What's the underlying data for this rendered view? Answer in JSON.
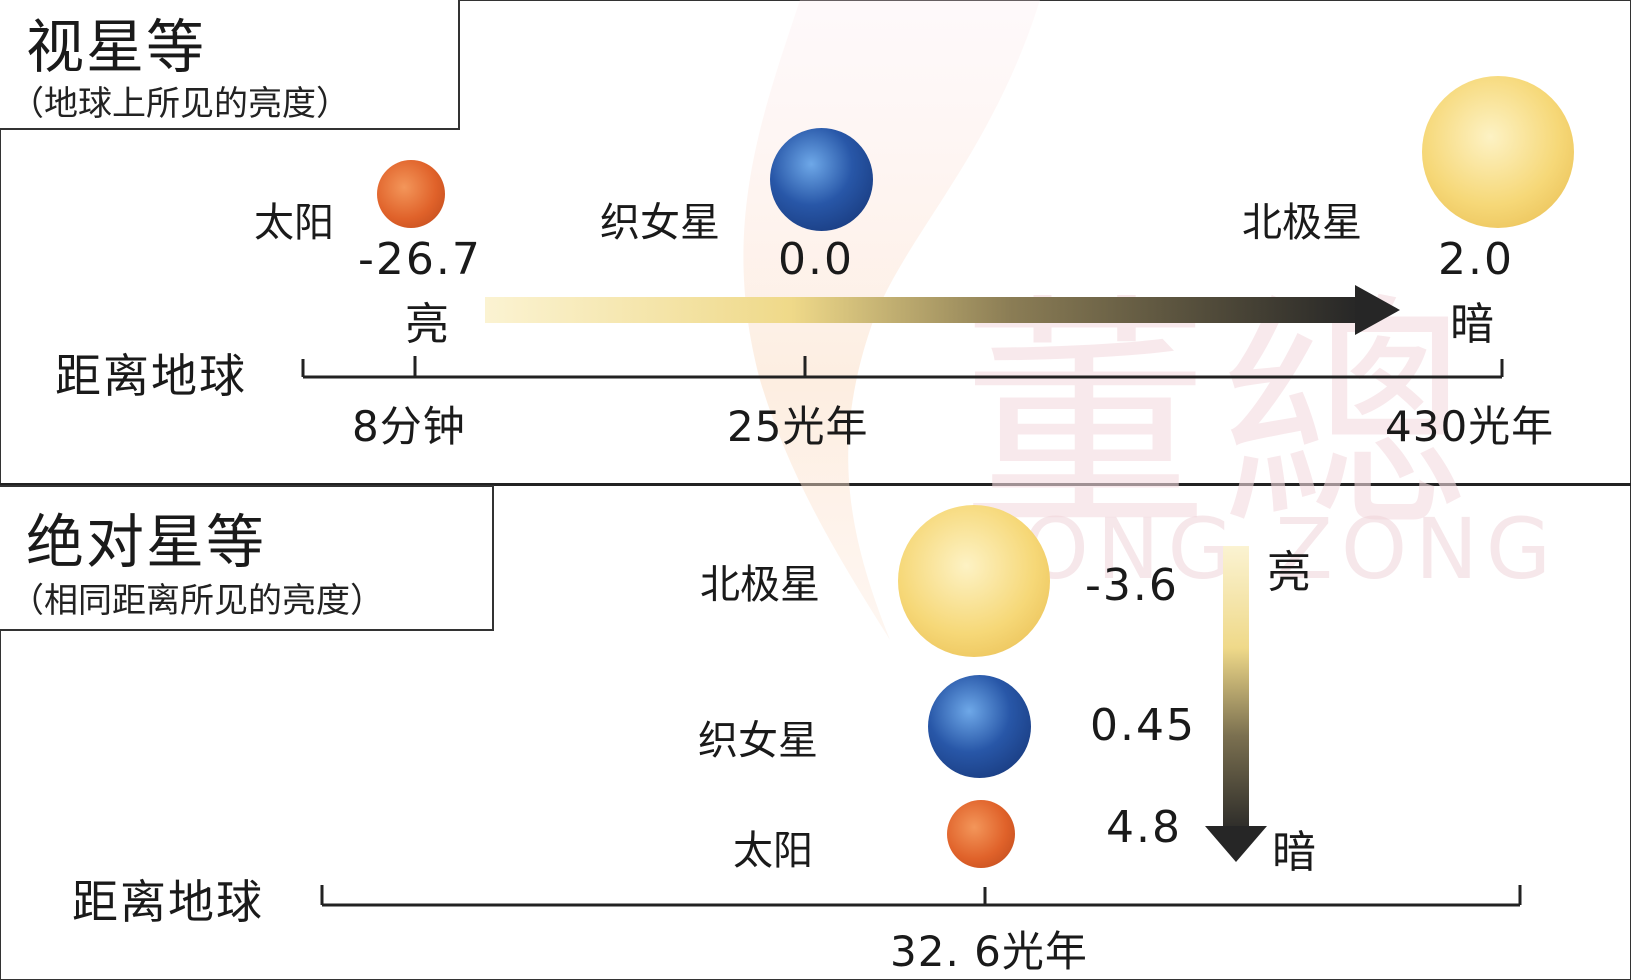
{
  "colors": {
    "sun": "#e0622a",
    "vega": "#2857a8",
    "polaris": "#f6d878",
    "arrow_bright": "#fbf0c4",
    "arrow_dark": "#2a2a2a",
    "watermark": "#f4dbe0"
  },
  "top": {
    "title": "视星等",
    "subtitle": "（地球上所见的亮度）",
    "stars": [
      {
        "name": "太阳",
        "magnitude": "-26.7",
        "icon": "sun-ball"
      },
      {
        "name": "织女星",
        "magnitude": "0.0",
        "icon": "vega-ball"
      },
      {
        "name": "北极星",
        "magnitude": "2.0",
        "icon": "polaris-ball"
      }
    ],
    "bright_label": "亮",
    "dark_label": "暗",
    "distance_label": "距离地球",
    "ticks": [
      "8分钟",
      "25光年",
      "430光年"
    ]
  },
  "bottom": {
    "title": "绝对星等",
    "subtitle": "（相同距离所见的亮度）",
    "stars": [
      {
        "name": "北极星",
        "magnitude": "-3.6",
        "icon": "polaris-ball"
      },
      {
        "name": "织女星",
        "magnitude": "0.45",
        "icon": "vega-ball"
      },
      {
        "name": "太阳",
        "magnitude": "4.8",
        "icon": "sun-ball"
      }
    ],
    "bright_label": "亮",
    "dark_label": "暗",
    "distance_label": "距离地球",
    "tick": "32. 6光年"
  },
  "watermark": {
    "text": "董總",
    "subtext": "DONG ZONG"
  }
}
